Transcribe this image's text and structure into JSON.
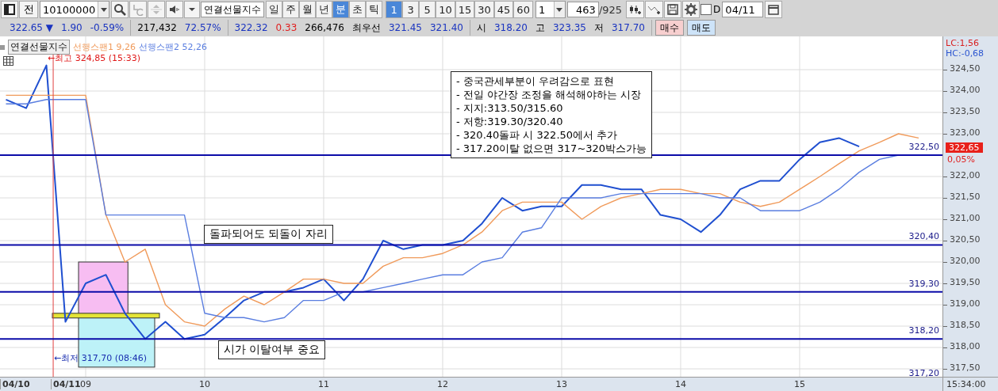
{
  "toolbar": {
    "prefix_button": "전",
    "code_field": {
      "value": "10100000"
    },
    "name_field": {
      "value": "연결선물지수"
    },
    "period_buttons": [
      {
        "label": "일",
        "selected": false
      },
      {
        "label": "주",
        "selected": false
      },
      {
        "label": "월",
        "selected": false
      },
      {
        "label": "년",
        "selected": false
      },
      {
        "label": "분",
        "selected": true
      },
      {
        "label": "초",
        "selected": false
      },
      {
        "label": "틱",
        "selected": false
      }
    ],
    "interval_buttons": [
      {
        "label": "1",
        "selected": true
      },
      {
        "label": "3",
        "selected": false
      },
      {
        "label": "5",
        "selected": false
      },
      {
        "label": "10",
        "selected": false
      },
      {
        "label": "15",
        "selected": false
      },
      {
        "label": "30",
        "selected": false
      },
      {
        "label": "45",
        "selected": false
      },
      {
        "label": "60",
        "selected": false
      }
    ],
    "count_combo": {
      "value": "1"
    },
    "count_field": {
      "value": "463"
    },
    "total": "/925",
    "d_checkbox": {
      "label": "D",
      "checked": false
    },
    "date_field": {
      "value": "04/11"
    }
  },
  "quote_bar": {
    "groups": [
      [
        {
          "text": "322.65 ▼",
          "color": "#1a34c0"
        },
        {
          "text": "1.90",
          "color": "#1a34c0"
        },
        {
          "text": "-0.59%",
          "color": "#1a34c0"
        }
      ],
      [
        {
          "text": "217,432",
          "color": "#000000"
        },
        {
          "text": "72.57%",
          "color": "#1a34c0"
        }
      ],
      [
        {
          "text": "322.32",
          "color": "#1a34c0"
        },
        {
          "text": "0.33",
          "color": "#e02020"
        },
        {
          "text": "266,476",
          "color": "#000000"
        },
        {
          "text": "최우선"
        },
        {
          "text": "321.45",
          "color": "#1a34c0"
        },
        {
          "text": "321.40",
          "color": "#1a34c0"
        }
      ],
      [
        {
          "text": "시"
        },
        {
          "text": "318.20",
          "color": "#1a34c0"
        },
        {
          "text": "고"
        },
        {
          "text": "323.35",
          "color": "#1a34c0"
        },
        {
          "text": "저"
        },
        {
          "text": "317.70",
          "color": "#1a34c0"
        }
      ]
    ],
    "buttons": [
      {
        "label": "매수",
        "kind": "buy"
      },
      {
        "label": "매도",
        "kind": "sell"
      }
    ]
  },
  "legend": {
    "params": [
      "9,26",
      "52,26"
    ]
  },
  "date_labels": [
    "04/10",
    "04/11"
  ],
  "markers": [
    {
      "text": "←최고 324,85 (15:33)",
      "color": "#e01818"
    },
    {
      "text": "←최저 317,70 (08:46)",
      "color": "#1a2fb0"
    }
  ],
  "notes": [
    {
      "lines": [
        "- 중국관세부분이 우려감으로 표현",
        "- 전일 야간장 조정을 해석해야하는 시장",
        "- 지지:313.50/315.60",
        "- 저항:319.30/320.40",
        "- 320.40돌파 시 322.50에서 추가",
        "- 317.20이탈 없으면 317~320박스가능"
      ]
    },
    {
      "lines": [
        "돌파되어도 되돌이 자리"
      ]
    },
    {
      "lines": [
        "시가 이탈여부 중요"
      ]
    }
  ],
  "right_axis": {
    "lc": "LC:1,56",
    "hc": "HC:-0,68",
    "last_price": "322,65",
    "last_change": "0,05%",
    "clock": "15:34:00"
  },
  "chart_data": {
    "type": "line",
    "x": [
      8.33,
      8.5,
      8.67,
      8.83,
      9,
      9.17,
      9.33,
      9.5,
      9.67,
      9.83,
      10,
      10.17,
      10.33,
      10.5,
      10.67,
      10.83,
      11,
      11.17,
      11.33,
      11.5,
      11.67,
      11.83,
      12,
      12.17,
      12.33,
      12.5,
      12.67,
      12.83,
      13,
      13.17,
      13.33,
      13.5,
      13.67,
      13.83,
      14,
      14.17,
      14.33,
      14.5,
      14.67,
      14.83,
      15,
      15.17,
      15.33,
      15.5,
      15.67,
      15.83,
      16
    ],
    "series": [
      {
        "name": "연결선물지수",
        "color": "#1f4fd0",
        "values": [
          323.8,
          323.6,
          324.6,
          318.6,
          319.5,
          319.7,
          318.8,
          318.2,
          318.6,
          318.2,
          318.3,
          318.7,
          319.1,
          319.3,
          319.3,
          319.4,
          319.6,
          319.1,
          319.6,
          320.5,
          320.3,
          320.4,
          320.4,
          320.5,
          320.9,
          321.5,
          321.2,
          321.3,
          321.3,
          321.8,
          321.8,
          321.7,
          321.7,
          321.1,
          321.0,
          320.7,
          321.1,
          321.7,
          321.9,
          321.9,
          322.4,
          322.8,
          322.9,
          322.7,
          null,
          null,
          null
        ]
      },
      {
        "name": "선행스팬1",
        "color": "#f09a5a",
        "values": [
          323.9,
          323.9,
          323.9,
          323.9,
          323.9,
          321.1,
          320.0,
          320.3,
          319.0,
          318.6,
          318.5,
          318.9,
          319.2,
          319.0,
          319.3,
          319.6,
          319.6,
          319.5,
          319.5,
          319.9,
          320.1,
          320.1,
          320.2,
          320.4,
          320.7,
          321.2,
          321.4,
          321.4,
          321.4,
          321.0,
          321.3,
          321.5,
          321.6,
          321.7,
          321.7,
          321.6,
          321.6,
          321.4,
          321.3,
          321.4,
          321.7,
          322.0,
          322.3,
          322.6,
          322.8,
          323.0,
          322.9
        ]
      },
      {
        "name": "선행스팬2",
        "color": "#5a7ee0",
        "values": [
          323.7,
          323.7,
          323.8,
          323.8,
          323.8,
          321.1,
          321.1,
          321.1,
          321.1,
          321.1,
          318.8,
          318.7,
          318.7,
          318.6,
          318.7,
          319.1,
          319.1,
          319.3,
          319.3,
          319.4,
          319.5,
          319.6,
          319.7,
          319.7,
          320.0,
          320.1,
          320.7,
          320.8,
          321.5,
          321.5,
          321.5,
          321.6,
          321.6,
          321.6,
          321.6,
          321.6,
          321.5,
          321.5,
          321.2,
          321.2,
          321.2,
          321.4,
          321.7,
          322.1,
          322.4,
          322.5,
          322.5
        ]
      }
    ],
    "grid": true,
    "xlim": [
      8.28,
      16.667
    ],
    "ylim": [
      317.315,
      325.278
    ],
    "yticks": [
      {
        "value": 324.5,
        "label": "324,50"
      },
      {
        "value": 324,
        "label": "324,00"
      },
      {
        "value": 323.5,
        "label": "323,50"
      },
      {
        "value": 323,
        "label": "323,00"
      },
      {
        "value": 322,
        "label": "322,00"
      },
      {
        "value": 321.5,
        "label": "321,50"
      },
      {
        "value": 321,
        "label": "321,00"
      },
      {
        "value": 320.5,
        "label": "320,50"
      },
      {
        "value": 320,
        "label": "320,00"
      },
      {
        "value": 319.5,
        "label": "319,50"
      },
      {
        "value": 319,
        "label": "319,00"
      },
      {
        "value": 318.5,
        "label": "318,50"
      },
      {
        "value": 318,
        "label": "318,00"
      },
      {
        "value": 317.5,
        "label": "317,50"
      }
    ],
    "xticks": [
      {
        "value": 9,
        "label": "09"
      },
      {
        "value": 10,
        "label": "10"
      },
      {
        "value": 11,
        "label": "11"
      },
      {
        "value": 12,
        "label": "12"
      },
      {
        "value": 13,
        "label": "13"
      },
      {
        "value": 14,
        "label": "14"
      },
      {
        "value": 15,
        "label": "15"
      }
    ],
    "ref_lines": [
      {
        "axis": "x",
        "value": 8.727,
        "color": "#e04040"
      },
      {
        "axis": "y",
        "value": 322.5,
        "label": "322,50"
      },
      {
        "axis": "y",
        "value": 320.4,
        "label": "320,40"
      },
      {
        "axis": "y",
        "value": 319.3,
        "label": "319,30"
      },
      {
        "axis": "y",
        "value": 318.2,
        "label": "318,20"
      }
    ]
  },
  "cut_level_label": "317,20"
}
